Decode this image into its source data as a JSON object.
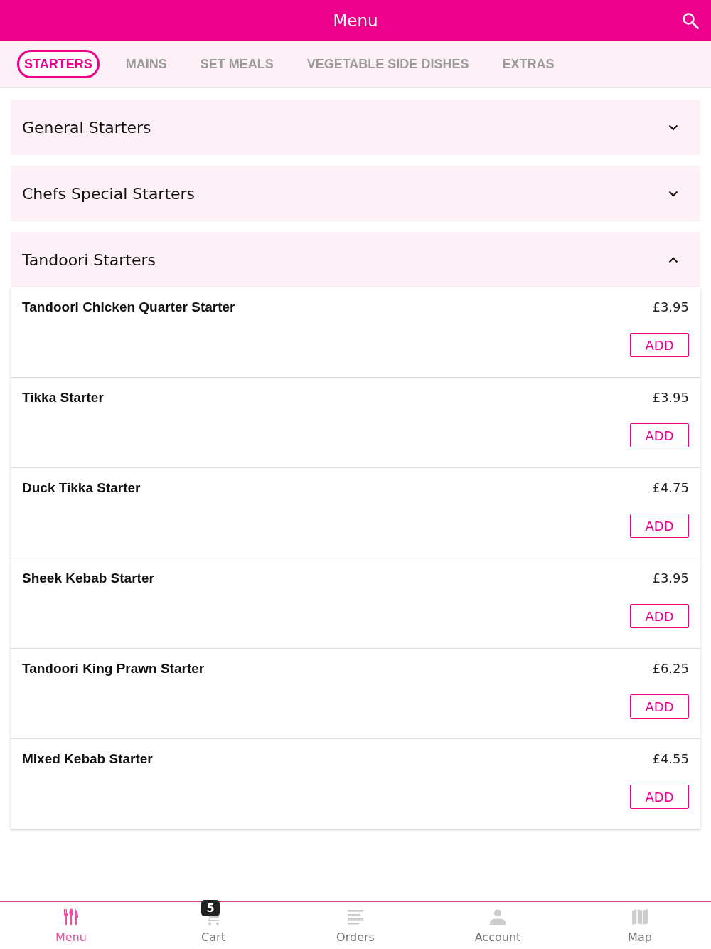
{
  "header": {
    "title": "Menu"
  },
  "tabs": [
    {
      "label": "STARTERS",
      "selected": true
    },
    {
      "label": "MAINS",
      "selected": false
    },
    {
      "label": "SET MEALS",
      "selected": false
    },
    {
      "label": "VEGETABLE SIDE DISHES",
      "selected": false
    },
    {
      "label": "EXTRAS",
      "selected": false
    }
  ],
  "sections": [
    {
      "title": "General Starters",
      "expanded": false
    },
    {
      "title": "Chefs Special Starters",
      "expanded": false
    },
    {
      "title": "Tandoori Starters",
      "expanded": true,
      "items": [
        {
          "name": "Tandoori Chicken Quarter Starter",
          "price": "£3.95",
          "button": "ADD"
        },
        {
          "name": "Tikka Starter",
          "price": "£3.95",
          "button": "ADD"
        },
        {
          "name": "Duck Tikka Starter",
          "price": "£4.75",
          "button": "ADD"
        },
        {
          "name": "Sheek Kebab Starter",
          "price": "£3.95",
          "button": "ADD"
        },
        {
          "name": "Tandoori King Prawn Starter",
          "price": "£6.25",
          "button": "ADD"
        },
        {
          "name": "Mixed Kebab Starter",
          "price": "£4.55",
          "button": "ADD"
        }
      ]
    }
  ],
  "bottom_nav": [
    {
      "kind": "cutlery",
      "label": "Menu",
      "selected": true
    },
    {
      "kind": "cart",
      "label": "Cart",
      "selected": false,
      "badge": "5"
    },
    {
      "kind": "list",
      "label": "Orders",
      "selected": false
    },
    {
      "kind": "person",
      "label": "Account",
      "selected": false
    },
    {
      "kind": "map",
      "label": "Map",
      "selected": false
    }
  ]
}
